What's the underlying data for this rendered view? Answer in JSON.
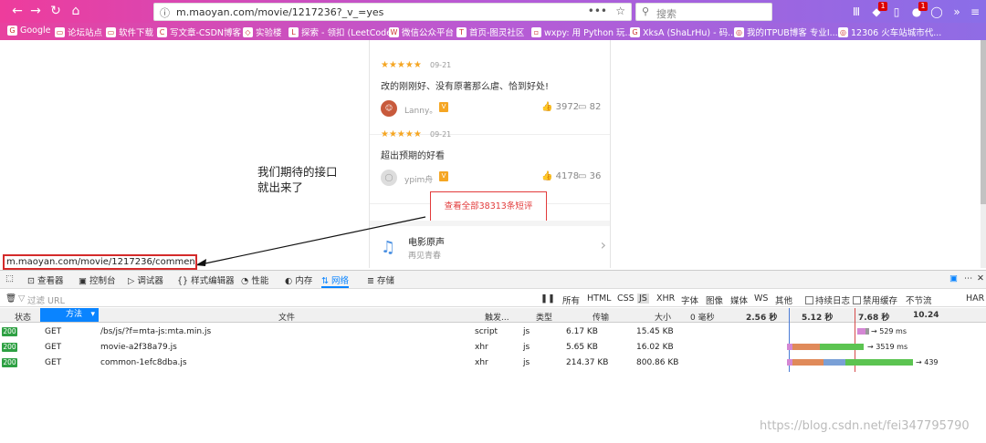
{
  "browser": {
    "url": "m.maoyan.com/movie/1217236?_v_=yes",
    "search_placeholder": "搜索",
    "badge_1": "1",
    "badge_2": "1"
  },
  "bookmarks": [
    {
      "label": "Google"
    },
    {
      "label": "论坛站点"
    },
    {
      "label": "软件下载"
    },
    {
      "label": "写文章-CSDN博客"
    },
    {
      "label": "实验楼"
    },
    {
      "label": "探索 - 领扣 (LeetCode)"
    },
    {
      "label": "微信公众平台"
    },
    {
      "label": "首页-图灵社区"
    },
    {
      "label": "wxpy: 用 Python 玩..."
    },
    {
      "label": "XksA (ShaLrHu) - 码..."
    },
    {
      "label": "我的ITPUB博客 专业I..."
    },
    {
      "label": "12306 火车站城市代..."
    }
  ],
  "reviews": [
    {
      "stars": "★★★★★",
      "date": "09-21",
      "text": "改的刚刚好、没有原著那么虐、恰到好处!",
      "user": "Lanny。",
      "likes": "3972",
      "comments": "82"
    },
    {
      "stars": "★★★★★",
      "date": "09-21",
      "text": "超出预期的好看",
      "user": "ypim舟",
      "likes": "4178",
      "comments": "36"
    }
  ],
  "view_all": "查看全部38313条短评",
  "music": {
    "title": "电影原声",
    "subtitle": "再见青春"
  },
  "annotation": {
    "line1": "我们期待的接口",
    "line2": "就出来了"
  },
  "url_popup": "m.maoyan.com/movie/1217236/comments?_v_=yes",
  "devtools": {
    "tabs": [
      "查看器",
      "控制台",
      "调试器",
      "样式编辑器",
      "性能",
      "内存",
      "网络",
      "存储"
    ],
    "active_tab": "网络",
    "filter_placeholder": "过滤 URL",
    "filter_types": [
      "所有",
      "HTML",
      "CSS",
      "JS",
      "XHR",
      "字体",
      "图像",
      "媒体",
      "WS",
      "其他"
    ],
    "active_filter": "JS",
    "persist_log": "持续日志",
    "disable_cache": "禁用缓存",
    "throttle": "不节流",
    "har": "HAR ▾",
    "columns": [
      "状态",
      "方法",
      "文件",
      "触发...",
      "类型",
      "传输",
      "大小"
    ],
    "timeline_ticks": [
      "0 毫秒",
      "2.56 秒",
      "5.12 秒",
      "7.68 秒",
      "10.24"
    ],
    "requests": [
      {
        "status": "200",
        "method": "GET",
        "file": "/bs/js/?f=mta-js:mta.min.js",
        "cause": "script",
        "type": "js",
        "transferred": "6.17 KB",
        "size": "15.45 KB",
        "time": "→ 529 ms"
      },
      {
        "status": "200",
        "method": "GET",
        "file": "movie-a2f38a79.js",
        "cause": "xhr",
        "type": "js",
        "transferred": "5.65 KB",
        "size": "16.02 KB",
        "time": "→ 3519 ms"
      },
      {
        "status": "200",
        "method": "GET",
        "file": "common-1efc8dba.js",
        "cause": "xhr",
        "type": "js",
        "transferred": "214.37 KB",
        "size": "800.86 KB",
        "time": "→ 439"
      }
    ]
  },
  "watermark": "https://blog.csdn.net/fei347795790",
  "colors": {
    "accent": "#0a84ff",
    "status_ok": "#2ea043",
    "highlight": "#d42a2a",
    "star": "#f5a623"
  }
}
